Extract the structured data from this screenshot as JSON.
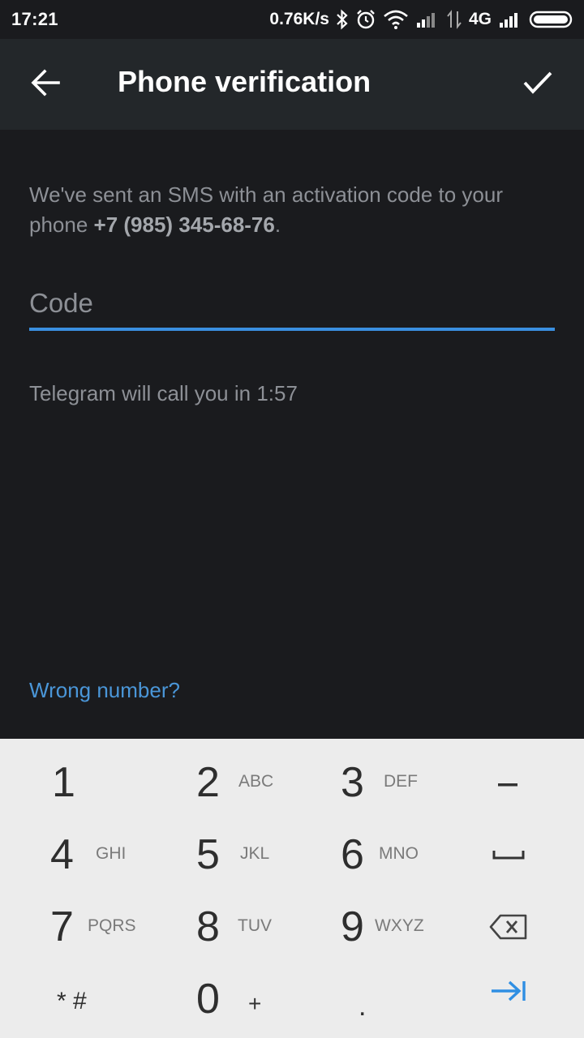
{
  "status_bar": {
    "time": "17:21",
    "net_speed": "0.76K/s",
    "network_type": "4G",
    "icons": [
      "bluetooth-icon",
      "alarm-icon",
      "wifi-icon",
      "signal-icon",
      "data-arrows-icon",
      "signal-icon",
      "battery-icon"
    ]
  },
  "app_bar": {
    "title": "Phone verification",
    "back_icon": "arrow-left-icon",
    "confirm_icon": "checkmark-icon"
  },
  "content": {
    "info_prefix": "We've sent an SMS with an activation code to your phone ",
    "phone_number": "+7 (985) 345-68-76",
    "info_suffix": ".",
    "code_placeholder": "Code",
    "code_value": "",
    "call_text": "Telegram will call you in 1:57",
    "wrong_number": "Wrong number?"
  },
  "colors": {
    "accent": "#3a8fe0",
    "link": "#4a96d8",
    "background": "#1a1b1e",
    "app_bar": "#23272a",
    "keypad_bg": "#ececec"
  },
  "keypad": {
    "keys": [
      {
        "num": "1",
        "letters": ""
      },
      {
        "num": "2",
        "letters": "ABC"
      },
      {
        "num": "3",
        "letters": "DEF"
      },
      {
        "num": "4",
        "letters": "GHI"
      },
      {
        "num": "5",
        "letters": "JKL"
      },
      {
        "num": "6",
        "letters": "MNO"
      },
      {
        "num": "7",
        "letters": "PQRS"
      },
      {
        "num": "8",
        "letters": "TUV"
      },
      {
        "num": "9",
        "letters": "WXYZ"
      },
      {
        "num": "* #",
        "letters": ""
      },
      {
        "num": "0",
        "letters": "+"
      },
      {
        "num": ".",
        "letters": ""
      }
    ],
    "side_keys": [
      "minus-icon",
      "space-icon",
      "backspace-icon",
      "next-icon"
    ]
  }
}
